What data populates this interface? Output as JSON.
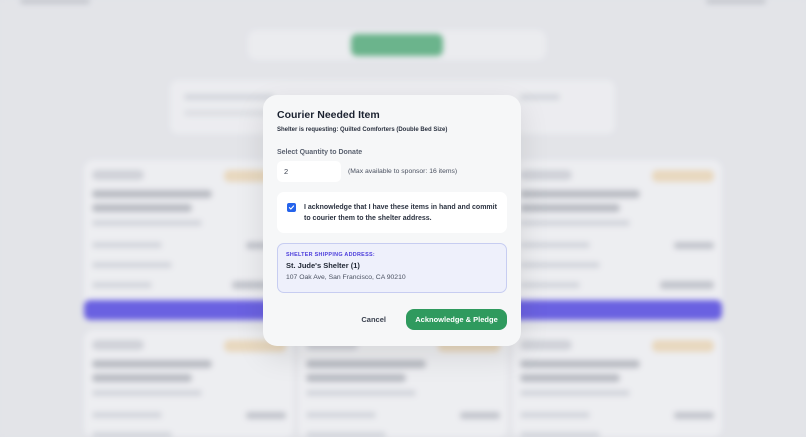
{
  "background": {
    "tabs": [
      "",
      "",
      ""
    ]
  },
  "modal": {
    "title": "Courier Needed Item",
    "subtitle": "Shelter is requesting: Quilted Comforters (Double Bed Size)",
    "quantity_label": "Select Quantity to Donate",
    "quantity_value": "2",
    "quantity_hint": "(Max available to sponsor: 16 items)",
    "acknowledge_checked": true,
    "acknowledge_text": "I acknowledge that I have these items in hand and commit to courier them to the shelter address.",
    "address_label": "SHELTER SHIPPING ADDRESS:",
    "address_name": "St. Jude's Shelter (1)",
    "address_line": "107 Oak Ave, San Francisco, CA 90210",
    "cancel_label": "Cancel",
    "confirm_label": "Acknowledge & Pledge"
  },
  "colors": {
    "primary_green": "#2f9a5e",
    "checkbox_blue": "#2563eb",
    "address_accent": "#4b3cdb"
  }
}
